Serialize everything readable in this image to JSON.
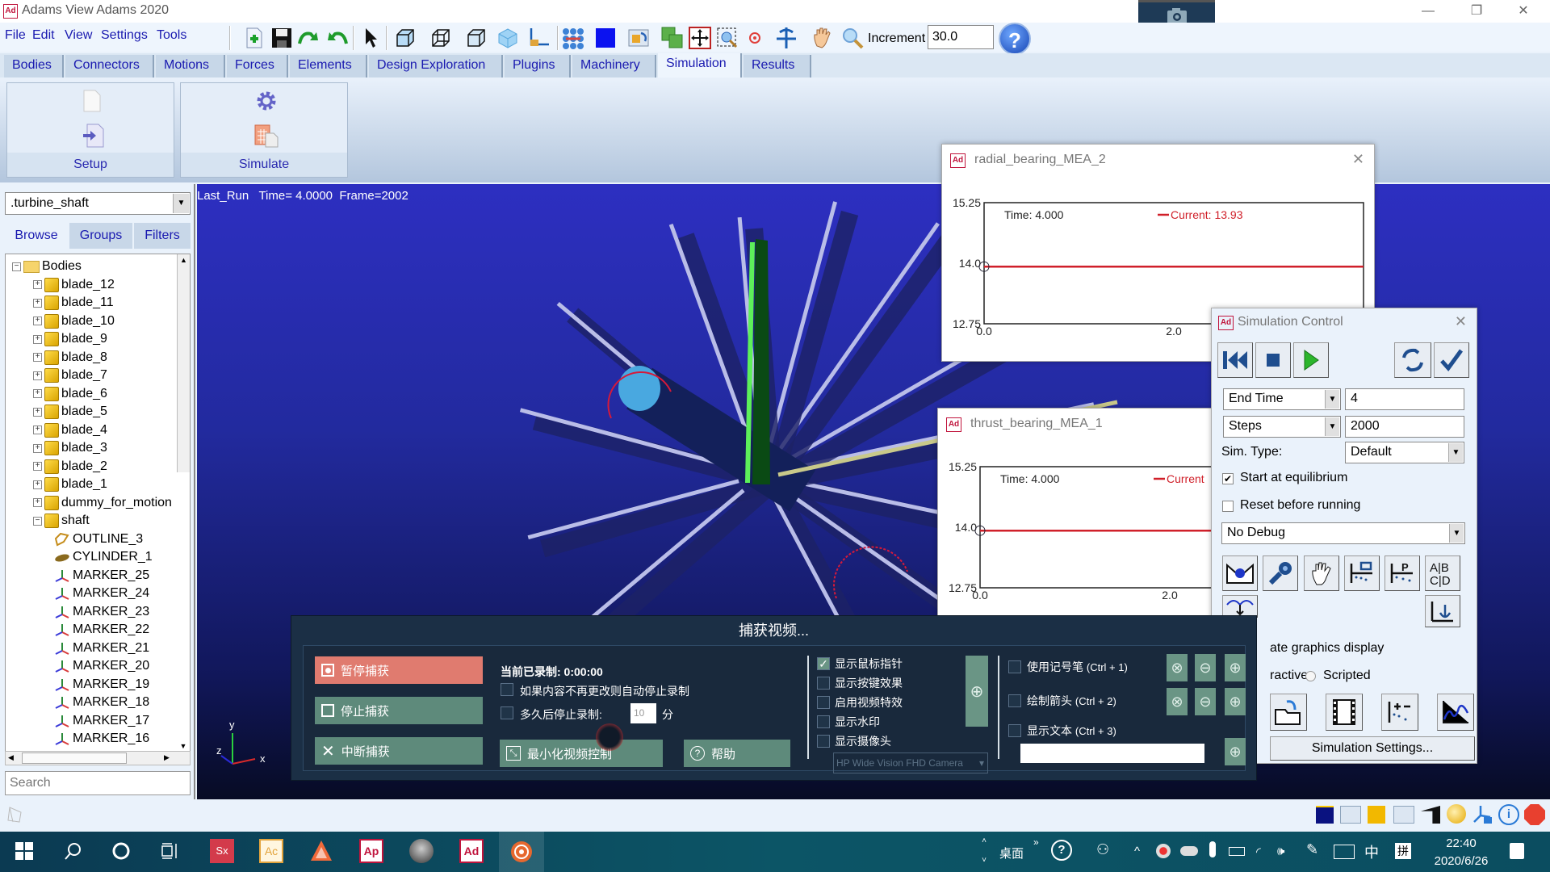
{
  "window": {
    "title": "Adams View Adams 2020",
    "app_icon": "Ad",
    "controls": {
      "minimize": "—",
      "restore": "❐",
      "close": "✕"
    }
  },
  "menu": [
    "File",
    "Edit",
    "View",
    "Settings",
    "Tools"
  ],
  "toolbar": {
    "icons": [
      "new-file-icon",
      "save-icon",
      "redo-icon",
      "undo-icon",
      "select-arrow-icon",
      "front-view-icon",
      "iso-view-icon",
      "side-view-icon",
      "shaded-cube-icon",
      "coordinate-system-icon",
      "grid-icon",
      "color-icon",
      "render-mode-icon",
      "fit-icon",
      "zoom-fit-icon",
      "zoom-box-icon",
      "center-icon",
      "rotate-icon",
      "pan-hand-icon",
      "zoom-icon"
    ],
    "increment_label": "Increment",
    "increment_value": "30.0",
    "help_label": "?"
  },
  "tabs": [
    "Bodies",
    "Connectors",
    "Motions",
    "Forces",
    "Elements",
    "Design Exploration",
    "Plugins",
    "Machinery",
    "Simulation",
    "Results"
  ],
  "active_tab": "Simulation",
  "ribbon": {
    "groups": [
      {
        "label": "Setup"
      },
      {
        "label": "Simulate"
      }
    ]
  },
  "browser": {
    "model": ".turbine_shaft",
    "tabs": [
      "Browse",
      "Groups",
      "Filters"
    ],
    "tree": [
      {
        "label": "Bodies",
        "level": 0,
        "type": "folder",
        "expanded": true
      },
      {
        "label": "blade_12",
        "level": 1,
        "type": "body"
      },
      {
        "label": "blade_11",
        "level": 1,
        "type": "body"
      },
      {
        "label": "blade_10",
        "level": 1,
        "type": "body"
      },
      {
        "label": "blade_9",
        "level": 1,
        "type": "body"
      },
      {
        "label": "blade_8",
        "level": 1,
        "type": "body"
      },
      {
        "label": "blade_7",
        "level": 1,
        "type": "body"
      },
      {
        "label": "blade_6",
        "level": 1,
        "type": "body"
      },
      {
        "label": "blade_5",
        "level": 1,
        "type": "body"
      },
      {
        "label": "blade_4",
        "level": 1,
        "type": "body"
      },
      {
        "label": "blade_3",
        "level": 1,
        "type": "body"
      },
      {
        "label": "blade_2",
        "level": 1,
        "type": "body"
      },
      {
        "label": "blade_1",
        "level": 1,
        "type": "body"
      },
      {
        "label": "dummy_for_motion",
        "level": 1,
        "type": "body"
      },
      {
        "label": "shaft",
        "level": 1,
        "type": "body",
        "expanded": true
      },
      {
        "label": "OUTLINE_3",
        "level": 2,
        "type": "outline"
      },
      {
        "label": "CYLINDER_1",
        "level": 2,
        "type": "cylinder"
      },
      {
        "label": "MARKER_25",
        "level": 2,
        "type": "marker"
      },
      {
        "label": "MARKER_24",
        "level": 2,
        "type": "marker"
      },
      {
        "label": "MARKER_23",
        "level": 2,
        "type": "marker"
      },
      {
        "label": "MARKER_22",
        "level": 2,
        "type": "marker"
      },
      {
        "label": "MARKER_21",
        "level": 2,
        "type": "marker"
      },
      {
        "label": "MARKER_20",
        "level": 2,
        "type": "marker"
      },
      {
        "label": "MARKER_19",
        "level": 2,
        "type": "marker"
      },
      {
        "label": "MARKER_18",
        "level": 2,
        "type": "marker"
      },
      {
        "label": "MARKER_17",
        "level": 2,
        "type": "marker"
      },
      {
        "label": "MARKER_16",
        "level": 2,
        "type": "marker"
      }
    ],
    "search_placeholder": "Search"
  },
  "viewport": {
    "status": "Last_Run   Time= 4.0000  Frame=2002",
    "axes": {
      "x": "x",
      "y": "y",
      "z": "z"
    }
  },
  "plots": [
    {
      "title": "radial_bearing_MEA_2",
      "time_label": "Time:  4.000",
      "legend": "Current:  13.93",
      "yticks": [
        "15.25",
        "14.0",
        "12.75"
      ],
      "xticks": [
        "0.0",
        "2.0"
      ],
      "ylim": [
        12.75,
        15.25
      ],
      "xlim": [
        0,
        4
      ],
      "value": 13.93,
      "line_color": "#d0202a"
    },
    {
      "title": "thrust_bearing_MEA_1",
      "time_label": "Time:  4.000",
      "legend": "Current",
      "yticks": [
        "15.25",
        "14.0",
        "12.75"
      ],
      "xticks": [
        "0.0",
        "2.0"
      ],
      "ylim": [
        12.75,
        15.25
      ],
      "xlim": [
        0,
        4
      ],
      "value": 13.93,
      "line_color": "#d0202a"
    }
  ],
  "sim_control": {
    "title": "Simulation Control",
    "end_mode": "End Time",
    "end_value": "4",
    "steps_mode": "Steps",
    "steps_value": "2000",
    "sim_type_label": "Sim. Type:",
    "sim_type": "Default",
    "start_equilibrium_label": "Start at equilibrium",
    "start_equilibrium": true,
    "reset_label": "Reset before running",
    "reset": false,
    "debug": "No Debug",
    "update_graphics_label": "ate graphics display",
    "mode_interactive": "ractive",
    "mode_scripted": "Scripted",
    "settings_button": "Simulation Settings..."
  },
  "capture": {
    "title": "捕获视频...",
    "pause": "暂停捕获",
    "stop": "停止捕获",
    "abort": "中断捕获",
    "recorded_label": "当前已录制: 0:00:00",
    "auto_stop": "如果内容不再更改则自动停止录制",
    "stop_after": "多久后停止录制:",
    "stop_after_value": "10",
    "stop_after_unit": "分",
    "minimize": "最小化视频控制",
    "help": "帮助",
    "options": [
      {
        "label": "显示鼠标指针",
        "checked": true
      },
      {
        "label": "显示按键效果",
        "checked": false
      },
      {
        "label": "启用视频特效",
        "checked": false
      },
      {
        "label": "显示水印",
        "checked": false
      },
      {
        "label": "显示摄像头",
        "checked": false
      }
    ],
    "camera": "HP Wide Vision FHD Camera",
    "annotations": [
      {
        "label": "使用记号笔",
        "shortcut": "(Ctrl + 1)"
      },
      {
        "label": "绘制箭头",
        "shortcut": "(Ctrl + 2)"
      },
      {
        "label": "显示文本",
        "shortcut": "(Ctrl + 3)"
      }
    ],
    "text_value": ""
  },
  "taskbar": {
    "desktop_label": "桌面",
    "ime_lang": "中",
    "ime_mode": "拼",
    "time": "22:40",
    "date": "2020/6/26",
    "apps": [
      "Sx",
      "Ac",
      "Adams",
      "Ap",
      "avatar",
      "Ad",
      "recorder"
    ]
  },
  "colors": {
    "accent": "#1a1ab0",
    "viewport_top": "#2d2fc1",
    "plot_line": "#d0202a",
    "capture_bg": "#1b2f45",
    "capture_pause": "#e07b6f",
    "capture_green": "#6a9585"
  }
}
